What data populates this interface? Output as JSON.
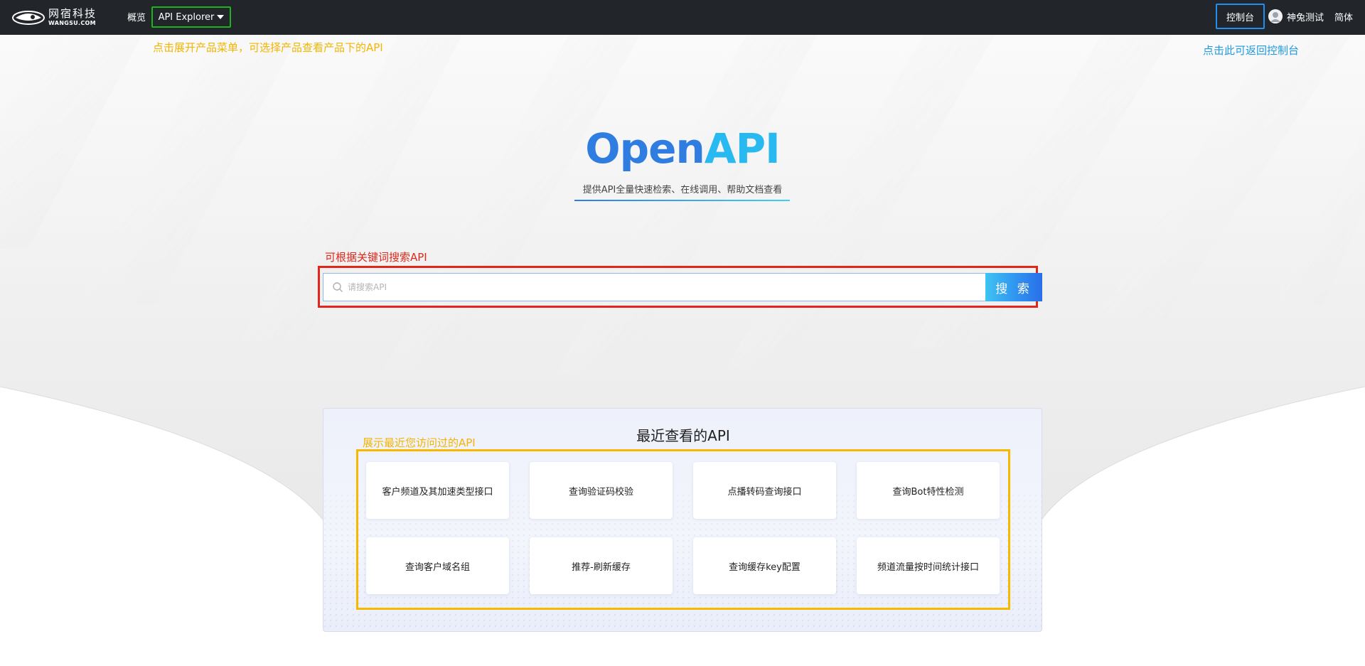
{
  "topbar": {
    "logo_cn": "网宿科技",
    "logo_en": "WANGSU.COM",
    "overview_label": "概览",
    "explorer_label": "API Explorer",
    "console_label": "控制台",
    "user_name": "神兔测试",
    "lang_label": "简体"
  },
  "annotations": {
    "explorer_hint": "点击展开产品菜单，可选择产品查看产品下的API",
    "console_hint": "点击此可返回控制台",
    "search_hint": "可根据关键词搜索API",
    "recent_hint": "展示最近您访问过的API"
  },
  "hero": {
    "title_part1": "Open",
    "title_part2": "API",
    "subtitle": "提供API全量快速检索、在线调用、帮助文档查看"
  },
  "search": {
    "placeholder": "请搜索API",
    "button_label": "搜 索"
  },
  "recent": {
    "title": "最近查看的API",
    "items": [
      "客户频道及其加速类型接口",
      "查询验证码校验",
      "点播转码查询接口",
      "查询Bot特性检测",
      "查询客户域名组",
      "推荐-刷新缓存",
      "查询缓存key配置",
      "频道流量按时间统计接口"
    ]
  },
  "colors": {
    "topbar_bg": "#222529",
    "explorer_highlight": "#1cb31c",
    "console_highlight": "#1f8ff0",
    "search_highlight": "#e0271a",
    "recent_highlight": "#f7b900",
    "title_blue": "#2f7de1",
    "title_cyan": "#28b9f0"
  }
}
